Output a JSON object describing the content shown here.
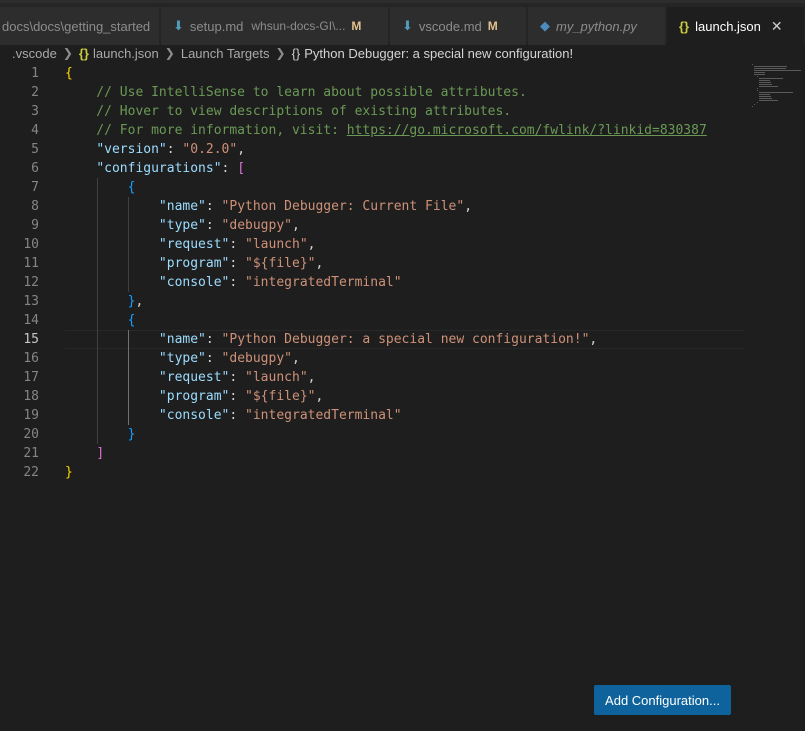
{
  "tabs": [
    {
      "label": "docs\\docs\\getting_started",
      "italic": false
    },
    {
      "label": "setup.md",
      "description": "whsun-docs-GI\\...",
      "status": "M",
      "icon": "markdown-icon"
    },
    {
      "label": "vscode.md",
      "status": "M",
      "icon": "markdown-icon"
    },
    {
      "label": "my_python.py",
      "italic": true,
      "icon": "python-icon"
    },
    {
      "label": "launch.json",
      "icon": "json-icon",
      "close": "✕",
      "active": true
    }
  ],
  "breadcrumb": {
    "folder": ".vscode",
    "file": "launch.json",
    "section": "Launch Targets",
    "item": "Python Debugger: a special new configuration!"
  },
  "editor": {
    "current_line": 15,
    "lines": [
      [
        {
          "t": "{",
          "c": "b1"
        }
      ],
      [
        {
          "t": "    // Use IntelliSense to learn about possible attributes.",
          "c": "c-cm"
        }
      ],
      [
        {
          "t": "    // Hover to view descriptions of existing attributes.",
          "c": "c-cm"
        }
      ],
      [
        {
          "t": "    // For more information, visit: ",
          "c": "c-cm"
        },
        {
          "t": "https://go.microsoft.com/fwlink/?linkid=830387",
          "c": "c-url"
        }
      ],
      [
        {
          "t": "    ",
          "c": "c-pun"
        },
        {
          "t": "\"version\"",
          "c": "c-key"
        },
        {
          "t": ": ",
          "c": "c-pun"
        },
        {
          "t": "\"0.2.0\"",
          "c": "c-str"
        },
        {
          "t": ",",
          "c": "c-pun"
        }
      ],
      [
        {
          "t": "    ",
          "c": "c-pun"
        },
        {
          "t": "\"configurations\"",
          "c": "c-key"
        },
        {
          "t": ": ",
          "c": "c-pun"
        },
        {
          "t": "[",
          "c": "b2"
        }
      ],
      [
        {
          "t": "        ",
          "c": "c-pun"
        },
        {
          "t": "{",
          "c": "b3"
        }
      ],
      [
        {
          "t": "            ",
          "c": "c-pun"
        },
        {
          "t": "\"name\"",
          "c": "c-key"
        },
        {
          "t": ": ",
          "c": "c-pun"
        },
        {
          "t": "\"Python Debugger: Current File\"",
          "c": "c-str"
        },
        {
          "t": ",",
          "c": "c-pun"
        }
      ],
      [
        {
          "t": "            ",
          "c": "c-pun"
        },
        {
          "t": "\"type\"",
          "c": "c-key"
        },
        {
          "t": ": ",
          "c": "c-pun"
        },
        {
          "t": "\"debugpy\"",
          "c": "c-str"
        },
        {
          "t": ",",
          "c": "c-pun"
        }
      ],
      [
        {
          "t": "            ",
          "c": "c-pun"
        },
        {
          "t": "\"request\"",
          "c": "c-key"
        },
        {
          "t": ": ",
          "c": "c-pun"
        },
        {
          "t": "\"launch\"",
          "c": "c-str"
        },
        {
          "t": ",",
          "c": "c-pun"
        }
      ],
      [
        {
          "t": "            ",
          "c": "c-pun"
        },
        {
          "t": "\"program\"",
          "c": "c-key"
        },
        {
          "t": ": ",
          "c": "c-pun"
        },
        {
          "t": "\"${file}\"",
          "c": "c-str"
        },
        {
          "t": ",",
          "c": "c-pun"
        }
      ],
      [
        {
          "t": "            ",
          "c": "c-pun"
        },
        {
          "t": "\"console\"",
          "c": "c-key"
        },
        {
          "t": ": ",
          "c": "c-pun"
        },
        {
          "t": "\"integratedTerminal\"",
          "c": "c-str"
        }
      ],
      [
        {
          "t": "        ",
          "c": "c-pun"
        },
        {
          "t": "}",
          "c": "b3"
        },
        {
          "t": ",",
          "c": "c-pun"
        }
      ],
      [
        {
          "t": "        ",
          "c": "c-pun"
        },
        {
          "t": "{",
          "c": "b3"
        }
      ],
      [
        {
          "t": "            ",
          "c": "c-pun"
        },
        {
          "t": "\"name\"",
          "c": "c-key"
        },
        {
          "t": ": ",
          "c": "c-pun"
        },
        {
          "t": "\"Python Debugger: a special new configuration!\"",
          "c": "c-str"
        },
        {
          "t": ",",
          "c": "c-pun"
        }
      ],
      [
        {
          "t": "            ",
          "c": "c-pun"
        },
        {
          "t": "\"type\"",
          "c": "c-key"
        },
        {
          "t": ": ",
          "c": "c-pun"
        },
        {
          "t": "\"debugpy\"",
          "c": "c-str"
        },
        {
          "t": ",",
          "c": "c-pun"
        }
      ],
      [
        {
          "t": "            ",
          "c": "c-pun"
        },
        {
          "t": "\"request\"",
          "c": "c-key"
        },
        {
          "t": ": ",
          "c": "c-pun"
        },
        {
          "t": "\"launch\"",
          "c": "c-str"
        },
        {
          "t": ",",
          "c": "c-pun"
        }
      ],
      [
        {
          "t": "            ",
          "c": "c-pun"
        },
        {
          "t": "\"program\"",
          "c": "c-key"
        },
        {
          "t": ": ",
          "c": "c-pun"
        },
        {
          "t": "\"${file}\"",
          "c": "c-str"
        },
        {
          "t": ",",
          "c": "c-pun"
        }
      ],
      [
        {
          "t": "            ",
          "c": "c-pun"
        },
        {
          "t": "\"console\"",
          "c": "c-key"
        },
        {
          "t": ": ",
          "c": "c-pun"
        },
        {
          "t": "\"integratedTerminal\"",
          "c": "c-str"
        }
      ],
      [
        {
          "t": "        ",
          "c": "c-pun"
        },
        {
          "t": "}",
          "c": "b3"
        }
      ],
      [
        {
          "t": "    ",
          "c": "c-pun"
        },
        {
          "t": "]",
          "c": "b2"
        }
      ],
      [
        {
          "t": "}",
          "c": "b1"
        }
      ]
    ]
  },
  "add_configuration_button": "Add Configuration...",
  "colors": {
    "accent_button": "#0e639c",
    "editor_background": "#1e1e1e",
    "modified_badge": "#e2c08d"
  }
}
